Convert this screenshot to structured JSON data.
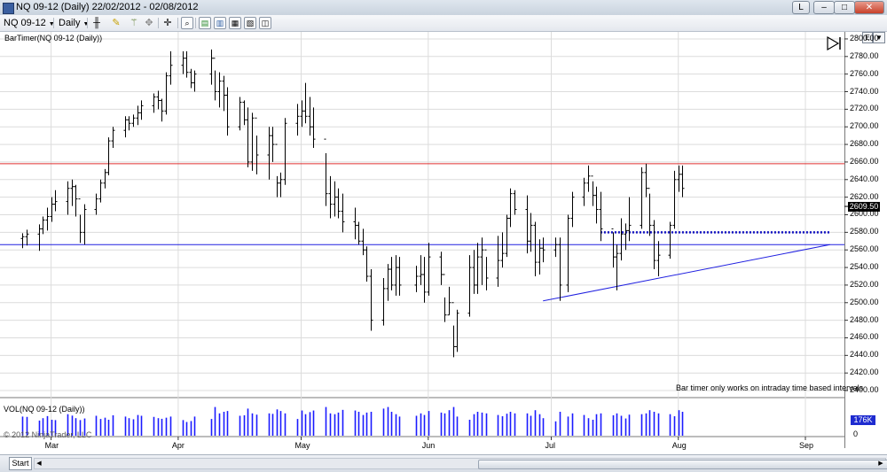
{
  "window": {
    "title": "NQ 09-12 (Daily)  22/02/2012 - 02/08/2012",
    "buttons": {
      "layout": "L",
      "minimize": "–",
      "maximize": "□",
      "close": "✕"
    }
  },
  "toolbar": {
    "instrument": "NQ 09-12",
    "interval": "Daily",
    "icons": [
      "bar-style-icon",
      "pencil-draw-icon",
      "magic-wand-icon",
      "drawing-tools-icon",
      "crosshair-icon",
      "zoom-icon",
      "chart-properties-icon",
      "indicators-icon",
      "strategies-icon",
      "data-box-icon",
      "snapshot-icon"
    ]
  },
  "chart": {
    "indicator_label": "BarTimer(NQ 09-12 (Daily))",
    "note": "Bar timer only works on intraday time based intervals",
    "volume_label": "VOL(NQ 09-12 (Daily))",
    "copyright": "© 2012 NinjaTrader, LLC",
    "price_axis_labels": [
      "2800.00",
      "2780.00",
      "2760.00",
      "2740.00",
      "2720.00",
      "2700.00",
      "2680.00",
      "2660.00",
      "2640.00",
      "2620.00",
      "2600.00",
      "2580.00",
      "2560.00",
      "2540.00",
      "2520.00",
      "2500.00",
      "2480.00",
      "2460.00",
      "2440.00",
      "2420.00",
      "2400.00"
    ],
    "last_price": "2609.50",
    "volume_axis_label": "0",
    "volume_tag": "176K",
    "date_labels": [
      "Mar",
      "Apr",
      "May",
      "Jun",
      "Jul",
      "Aug",
      "Sep"
    ],
    "colors": {
      "bar": "#000000",
      "volume": "#1a1aff",
      "resistance": "#e03030",
      "support": "#2020e0",
      "dotted": "#1010c0",
      "grid": "#dcdcdc"
    }
  },
  "bottom": {
    "tab_label": "Start"
  },
  "chart_data": {
    "type": "ohlc",
    "dates": [
      "2012-02-23",
      "2012-02-24",
      "2012-02-27",
      "2012-02-28",
      "2012-02-29",
      "2012-03-01",
      "2012-03-02",
      "2012-03-05",
      "2012-03-06",
      "2012-03-07",
      "2012-03-08",
      "2012-03-09",
      "2012-03-12",
      "2012-03-13",
      "2012-03-14",
      "2012-03-15",
      "2012-03-16",
      "2012-03-19",
      "2012-03-20",
      "2012-03-21",
      "2012-03-22",
      "2012-03-23",
      "2012-03-26",
      "2012-03-27",
      "2012-03-28",
      "2012-03-29",
      "2012-03-30",
      "2012-04-02",
      "2012-04-03",
      "2012-04-04",
      "2012-04-05",
      "2012-04-09",
      "2012-04-10",
      "2012-04-11",
      "2012-04-12",
      "2012-04-13",
      "2012-04-16",
      "2012-04-17",
      "2012-04-18",
      "2012-04-19",
      "2012-04-20",
      "2012-04-23",
      "2012-04-24",
      "2012-04-25",
      "2012-04-26",
      "2012-04-27",
      "2012-04-30",
      "2012-05-01",
      "2012-05-02",
      "2012-05-03",
      "2012-05-04",
      "2012-05-07",
      "2012-05-08",
      "2012-05-09",
      "2012-05-10",
      "2012-05-11",
      "2012-05-14",
      "2012-05-15",
      "2012-05-16",
      "2012-05-17",
      "2012-05-18",
      "2012-05-21",
      "2012-05-22",
      "2012-05-23",
      "2012-05-24",
      "2012-05-25",
      "2012-05-29",
      "2012-05-30",
      "2012-05-31",
      "2012-06-01",
      "2012-06-04",
      "2012-06-05",
      "2012-06-06",
      "2012-06-07",
      "2012-06-08",
      "2012-06-11",
      "2012-06-12",
      "2012-06-13",
      "2012-06-14",
      "2012-06-15",
      "2012-06-18",
      "2012-06-19",
      "2012-06-20",
      "2012-06-21",
      "2012-06-22",
      "2012-06-25",
      "2012-06-26",
      "2012-06-27",
      "2012-06-28",
      "2012-06-29",
      "2012-07-02",
      "2012-07-03",
      "2012-07-05",
      "2012-07-06",
      "2012-07-09",
      "2012-07-10",
      "2012-07-11",
      "2012-07-12",
      "2012-07-13",
      "2012-07-16",
      "2012-07-17",
      "2012-07-18",
      "2012-07-19",
      "2012-07-20",
      "2012-07-23",
      "2012-07-24",
      "2012-07-25",
      "2012-07-26",
      "2012-07-27",
      "2012-07-30",
      "2012-07-31",
      "2012-08-01",
      "2012-08-02"
    ],
    "ohlc": [
      [
        2573,
        2579,
        2562,
        2575
      ],
      [
        2575,
        2583,
        2565,
        2578
      ],
      [
        2578,
        2589,
        2559,
        2584
      ],
      [
        2584,
        2598,
        2578,
        2594
      ],
      [
        2594,
        2608,
        2582,
        2598
      ],
      [
        2598,
        2620,
        2592,
        2612
      ],
      [
        2612,
        2628,
        2604,
        2615
      ],
      [
        2615,
        2638,
        2600,
        2630
      ],
      [
        2630,
        2640,
        2610,
        2632
      ],
      [
        2632,
        2634,
        2598,
        2618
      ],
      [
        2618,
        2600,
        2568,
        2580
      ],
      [
        2580,
        2612,
        2566,
        2606
      ],
      [
        2606,
        2624,
        2600,
        2618
      ],
      [
        2618,
        2640,
        2614,
        2636
      ],
      [
        2636,
        2652,
        2630,
        2648
      ],
      [
        2648,
        2688,
        2645,
        2684
      ],
      [
        2684,
        2700,
        2676,
        2696
      ],
      [
        2696,
        2712,
        2688,
        2708
      ],
      [
        2708,
        2712,
        2696,
        2704
      ],
      [
        2704,
        2714,
        2700,
        2710
      ],
      [
        2710,
        2724,
        2702,
        2716
      ],
      [
        2716,
        2730,
        2708,
        2724
      ],
      [
        2724,
        2738,
        2716,
        2734
      ],
      [
        2734,
        2741,
        2720,
        2730
      ],
      [
        2730,
        2732,
        2706,
        2718
      ],
      [
        2718,
        2762,
        2714,
        2758
      ],
      [
        2758,
        2786,
        2748,
        2770
      ],
      [
        2770,
        2786,
        2760,
        2778
      ],
      [
        2778,
        2786,
        2756,
        2762
      ],
      [
        2762,
        2766,
        2744,
        2750
      ],
      [
        2750,
        2764,
        2740,
        2760
      ],
      [
        2760,
        2788,
        2748,
        2778
      ],
      [
        2778,
        2764,
        2730,
        2740
      ],
      [
        2740,
        2762,
        2722,
        2752
      ],
      [
        2752,
        2758,
        2718,
        2736
      ],
      [
        2736,
        2745,
        2690,
        2700
      ],
      [
        2700,
        2734,
        2696,
        2728
      ],
      [
        2728,
        2730,
        2702,
        2708
      ],
      [
        2708,
        2722,
        2654,
        2660
      ],
      [
        2660,
        2716,
        2650,
        2710
      ],
      [
        2710,
        2690,
        2646,
        2668
      ],
      [
        2668,
        2700,
        2640,
        2690
      ],
      [
        2690,
        2700,
        2660,
        2680
      ],
      [
        2680,
        2644,
        2620,
        2636
      ],
      [
        2636,
        2648,
        2620,
        2640
      ],
      [
        2640,
        2710,
        2634,
        2704
      ],
      [
        2704,
        2726,
        2690,
        2712
      ],
      [
        2712,
        2730,
        2700,
        2718
      ],
      [
        2718,
        2750,
        2704,
        2712
      ],
      [
        2712,
        2734,
        2690,
        2700
      ],
      [
        2700,
        2722,
        2676,
        2686
      ],
      [
        2686,
        2670,
        2610,
        2624
      ],
      [
        2624,
        2644,
        2596,
        2612
      ],
      [
        2612,
        2638,
        2598,
        2620
      ],
      [
        2620,
        2630,
        2596,
        2604
      ],
      [
        2604,
        2624,
        2580,
        2592
      ],
      [
        2592,
        2608,
        2572,
        2588
      ],
      [
        2588,
        2592,
        2566,
        2570
      ],
      [
        2570,
        2584,
        2554,
        2560
      ],
      [
        2560,
        2564,
        2524,
        2530
      ],
      [
        2530,
        2538,
        2468,
        2480
      ],
      [
        2480,
        2528,
        2474,
        2516
      ],
      [
        2516,
        2544,
        2502,
        2538
      ],
      [
        2538,
        2552,
        2514,
        2520
      ],
      [
        2520,
        2554,
        2508,
        2540
      ],
      [
        2540,
        2552,
        2508,
        2520
      ],
      [
        2520,
        2542,
        2512,
        2530
      ],
      [
        2530,
        2554,
        2520,
        2532
      ],
      [
        2532,
        2552,
        2500,
        2512
      ],
      [
        2512,
        2568,
        2508,
        2552
      ],
      [
        2552,
        2558,
        2520,
        2532
      ],
      [
        2532,
        2506,
        2478,
        2486
      ],
      [
        2486,
        2518,
        2486,
        2500
      ],
      [
        2500,
        2474,
        2438,
        2450
      ],
      [
        2450,
        2492,
        2444,
        2488
      ],
      [
        2488,
        2554,
        2484,
        2540
      ],
      [
        2540,
        2560,
        2510,
        2520
      ],
      [
        2520,
        2568,
        2510,
        2552
      ],
      [
        2552,
        2574,
        2520,
        2560
      ],
      [
        2560,
        2552,
        2514,
        2528
      ],
      [
        2528,
        2576,
        2518,
        2548
      ],
      [
        2548,
        2580,
        2540,
        2556
      ],
      [
        2556,
        2600,
        2552,
        2596
      ],
      [
        2596,
        2630,
        2586,
        2624
      ],
      [
        2624,
        2628,
        2600,
        2606
      ],
      [
        2606,
        2622,
        2556,
        2570
      ],
      [
        2570,
        2602,
        2558,
        2588
      ],
      [
        2588,
        2592,
        2530,
        2546
      ],
      [
        2546,
        2572,
        2532,
        2562
      ],
      [
        2562,
        2574,
        2546,
        2560
      ],
      [
        2560,
        2574,
        2552,
        2566
      ],
      [
        2566,
        2574,
        2502,
        2520
      ],
      [
        2520,
        2600,
        2512,
        2596
      ],
      [
        2596,
        2626,
        2586,
        2620
      ],
      [
        2620,
        2642,
        2610,
        2636
      ],
      [
        2636,
        2656,
        2626,
        2644
      ],
      [
        2644,
        2638,
        2610,
        2622
      ],
      [
        2622,
        2632,
        2590,
        2606
      ],
      [
        2606,
        2626,
        2570,
        2584
      ],
      [
        2584,
        2580,
        2540,
        2552
      ],
      [
        2552,
        2566,
        2514,
        2556
      ],
      [
        2556,
        2596,
        2548,
        2578
      ],
      [
        2578,
        2590,
        2560,
        2582
      ],
      [
        2582,
        2620,
        2570,
        2588
      ],
      [
        2588,
        2654,
        2584,
        2648
      ],
      [
        2648,
        2658,
        2620,
        2630
      ],
      [
        2630,
        2624,
        2576,
        2588
      ],
      [
        2588,
        2594,
        2538,
        2548
      ],
      [
        2548,
        2570,
        2530,
        2554
      ],
      [
        2554,
        2592,
        2550,
        2588
      ],
      [
        2588,
        2650,
        2584,
        2640
      ],
      [
        2640,
        2656,
        2626,
        2646
      ],
      [
        2646,
        2656,
        2620,
        2630
      ],
      [
        2630,
        2646,
        2600,
        2609.5
      ]
    ],
    "volume": [
      120,
      118,
      95,
      110,
      123,
      100,
      98,
      135,
      126,
      110,
      98,
      108,
      125,
      105,
      113,
      100,
      128,
      120,
      110,
      103,
      130,
      125,
      118,
      110,
      106,
      113,
      120,
      98,
      86,
      92,
      120,
      105,
      180,
      140,
      150,
      155,
      125,
      128,
      170,
      140,
      132,
      140,
      137,
      165,
      155,
      140,
      105,
      158,
      135,
      148,
      158,
      180,
      140,
      135,
      145,
      162,
      158,
      150,
      130,
      145,
      150,
      170,
      180,
      150,
      135,
      120,
      125,
      140,
      130,
      155,
      145,
      140,
      160,
      180,
      120,
      100,
      135,
      150,
      145,
      140,
      130,
      122,
      138,
      150,
      140,
      140,
      125,
      160,
      135,
      110,
      90,
      150,
      120,
      140,
      130,
      110,
      100,
      135,
      140,
      128,
      140,
      125,
      108,
      132,
      135,
      140,
      160,
      150,
      140,
      135,
      122,
      160,
      150
    ],
    "price_range": [
      2393,
      2808
    ],
    "volume_range": [
      0,
      200000
    ],
    "horizontal_lines": [
      {
        "price": 2658,
        "color": "red"
      },
      {
        "price": 2566,
        "color": "blue"
      }
    ],
    "dotted_line": {
      "price": 2580,
      "from": "2012-07-13",
      "to": "2012-09-07"
    },
    "trend_line": {
      "from": [
        "2012-06-29",
        2502
      ],
      "to": [
        "2012-09-07",
        2566
      ]
    }
  }
}
